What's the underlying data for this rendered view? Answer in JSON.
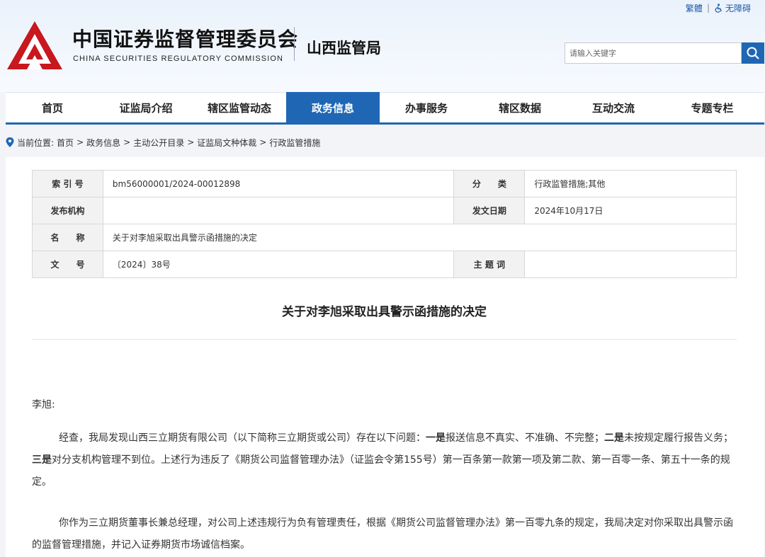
{
  "header": {
    "traditional_link": "繁體",
    "separator": "|",
    "accessibility_link": "无障碍",
    "org_name_cn": "中国证券监督管理委员会",
    "org_name_en": "CHINA SECURITIES REGULATORY COMMISSION",
    "bureau_name": "山西监管局",
    "search_placeholder": "请输入关键字",
    "colors": {
      "logo_red": "#c8171e",
      "brand_blue": "#1f67b4"
    }
  },
  "nav": {
    "items": [
      {
        "label": "首页",
        "active": false
      },
      {
        "label": "证监局介绍",
        "active": false
      },
      {
        "label": "辖区监管动态",
        "active": false
      },
      {
        "label": "政务信息",
        "active": true
      },
      {
        "label": "办事服务",
        "active": false
      },
      {
        "label": "辖区数据",
        "active": false
      },
      {
        "label": "互动交流",
        "active": false
      },
      {
        "label": "专题专栏",
        "active": false
      }
    ]
  },
  "breadcrumb": {
    "prefix": "当前位置:",
    "items": [
      "首页",
      "政务信息",
      "主动公开目录",
      "证监局文种体裁",
      "行政监管措施"
    ],
    "separator": ">"
  },
  "meta": {
    "index_label": "索 引 号",
    "index_value": "bm56000001/2024-00012898",
    "category_label": "分　　类",
    "category_value": "行政监管措施;其他",
    "publisher_label": "发布机构",
    "publisher_value": "",
    "date_label": "发文日期",
    "date_value": "2024年10月17日",
    "name_label": "名　　称",
    "name_value": "关于对李旭采取出具警示函措施的决定",
    "docno_label": "文　　号",
    "docno_value": "〔2024〕38号",
    "topic_label": "主 题 词",
    "topic_value": ""
  },
  "document": {
    "title": "关于对李旭采取出具警示函措施的决定",
    "salutation": "李旭:",
    "p1": {
      "lead": "经查，我局发现山西三立期货有限公司（以下简称三立期货或公司）存在以下问题：",
      "b1": "一是",
      "t1": "报送信息不真实、不准确、不完整；",
      "b2": "二是",
      "t2": "未按规定履行报告义务；",
      "b3": "三是",
      "t3": "对分支机构管理不到位。上述行为违反了《期货公司监督管理办法》（证监会令第155号）第一百条第一款第一项及第二款、第一百零一条、第五十一条的规定。"
    },
    "p2": "你作为三立期货董事长兼总经理，对公司上述违规行为负有管理责任，根据《期货公司监督管理办法》第一百零九条的规定，我局决定对你采取出具警示函的监督管理措施，并记入证券期货市场诚信档案。"
  }
}
